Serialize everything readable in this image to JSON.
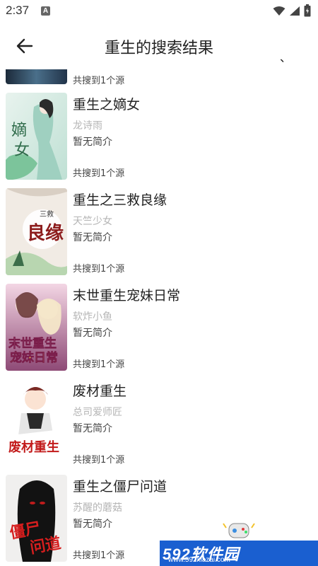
{
  "status_bar": {
    "time": "2:37",
    "notification_glyph": "A"
  },
  "header": {
    "title": "重生的搜索结果",
    "back_icon": "arrow-left-icon",
    "right_mark": "、"
  },
  "partial_row": {
    "source_count": "共搜到1个源"
  },
  "books": [
    {
      "title": "重生之嫡女",
      "author": "龙诗雨",
      "intro": "暂无简介",
      "source_count": "共搜到1个源",
      "cover_text": "嫡女"
    },
    {
      "title": "重生之三救良缘",
      "author": "天竺少女",
      "intro": "暂无简介",
      "source_count": "共搜到1个源",
      "cover_text": "三救良缘"
    },
    {
      "title": "末世重生宠妹日常",
      "author": "软炸小鱼",
      "intro": "暂无简介",
      "source_count": "共搜到1个源",
      "cover_text": "末世重生宠妹日常"
    },
    {
      "title": "废材重生",
      "author": "总司爱师匠",
      "intro": "暂无简介",
      "source_count": "共搜到1个源",
      "cover_text": "废材重生"
    },
    {
      "title": "重生之僵尸问道",
      "author": "苏醒的蘑菇",
      "intro": "暂无简介",
      "source_count": "共搜到1个源",
      "cover_text": "僵尸问道"
    }
  ],
  "watermark": {
    "brand": "592软件园",
    "url": "www.592xiazai.com"
  }
}
